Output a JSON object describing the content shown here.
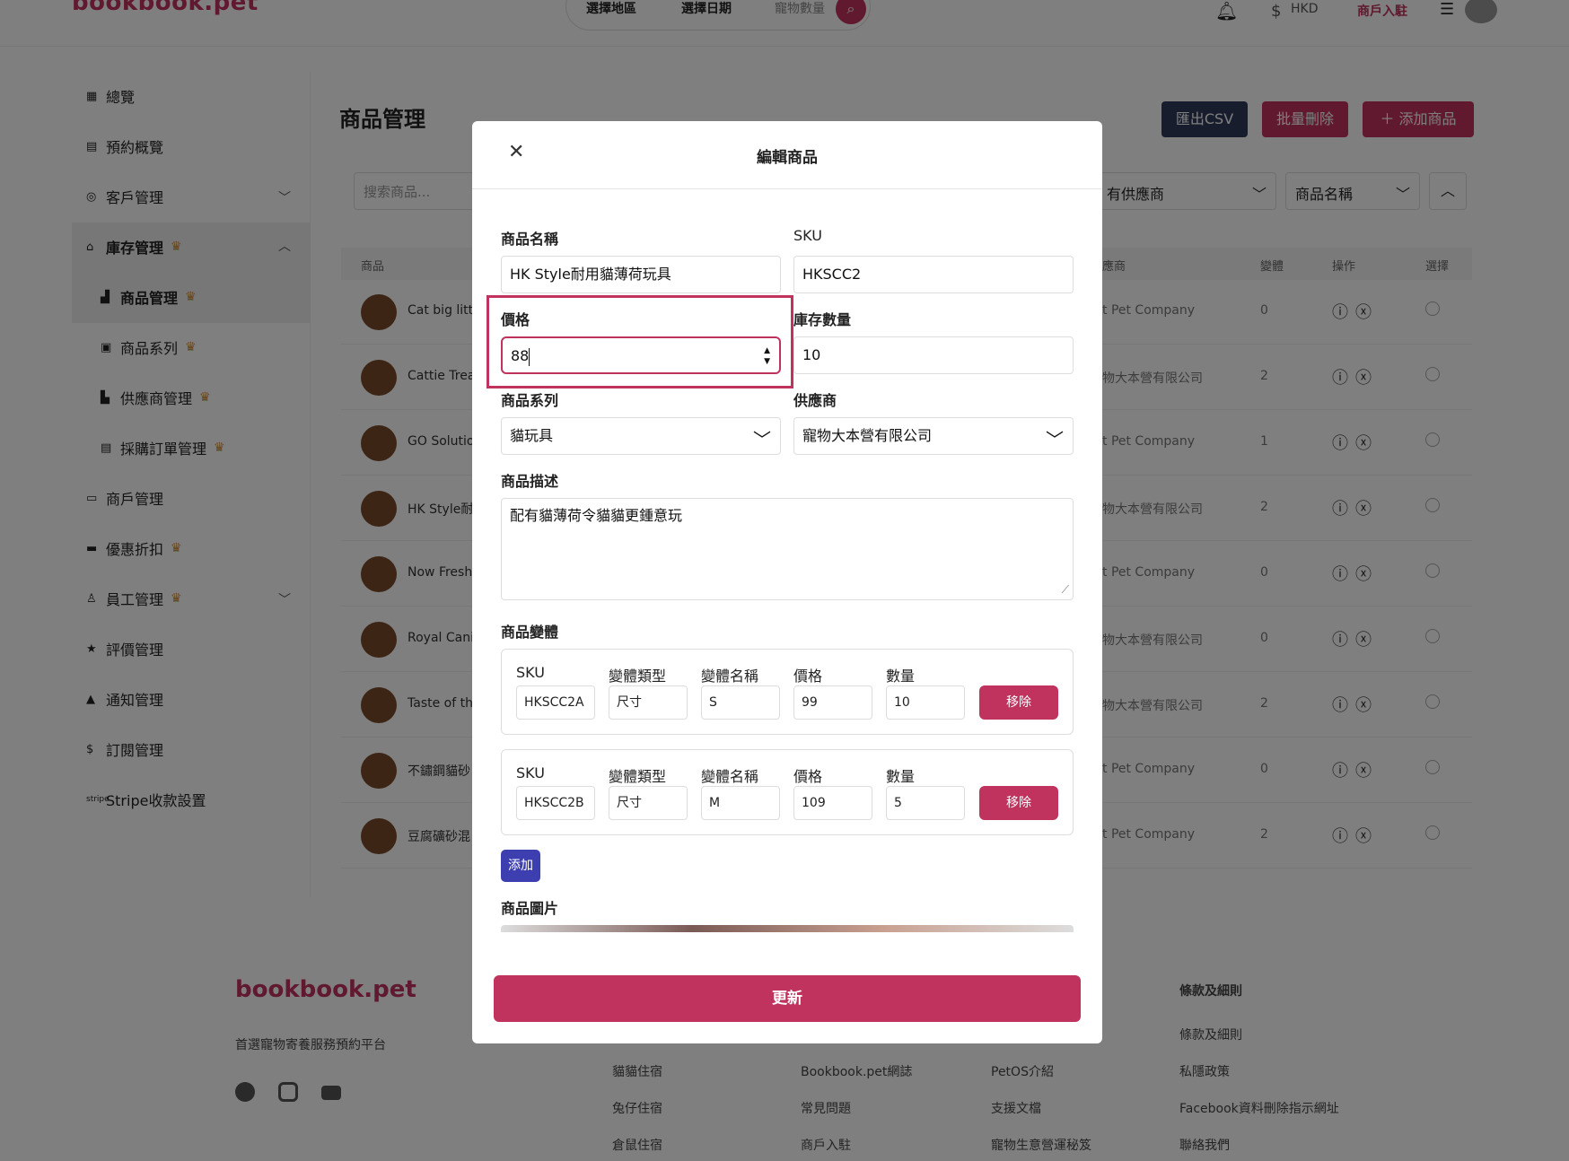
{
  "header": {
    "logo": "bookbook.pet",
    "search": {
      "region": "選擇地區",
      "date": "選擇日期",
      "pets": "寵物數量"
    },
    "currency": "HKD",
    "merchant": "商戶入駐"
  },
  "sidebar": {
    "items": [
      {
        "label": "總覽"
      },
      {
        "label": "預約概覽"
      },
      {
        "label": "客戶管理"
      },
      {
        "label": "庫存管理"
      },
      {
        "label": "商品管理"
      },
      {
        "label": "商品系列"
      },
      {
        "label": "供應商管理"
      },
      {
        "label": "採購訂單管理"
      },
      {
        "label": "商戶管理"
      },
      {
        "label": "優惠折扣"
      },
      {
        "label": "員工管理"
      },
      {
        "label": "評價管理"
      },
      {
        "label": "通知管理"
      },
      {
        "label": "訂閱管理"
      },
      {
        "label": "Stripe收款設置"
      }
    ]
  },
  "main": {
    "title": "商品管理",
    "buttons": {
      "export": "匯出CSV",
      "bulk_delete": "批量刪除",
      "add": "＋ 添加商品"
    },
    "search_placeholder": "搜索商品...",
    "filter_supplier": "有供應商",
    "sort_field": "商品名稱",
    "columns": {
      "product": "商品",
      "supplier": "應商",
      "variants": "變體",
      "actions": "操作",
      "select": "選擇"
    },
    "rows": [
      {
        "name": "Cat big litte",
        "supplier": "t Pet Company",
        "variants": "0"
      },
      {
        "name": "Cattie Treat",
        "supplier": "物大本營有限公司",
        "variants": "2"
      },
      {
        "name": "GO Solution",
        "supplier": "t Pet Company",
        "variants": "1"
      },
      {
        "name": "HK Style耐",
        "supplier": "物大本營有限公司",
        "variants": "2"
      },
      {
        "name": "Now Fresh",
        "supplier": "t Pet Company",
        "variants": "0"
      },
      {
        "name": "Royal Canin",
        "supplier": "物大本營有限公司",
        "variants": "0"
      },
      {
        "name": "Taste of the",
        "supplier": "物大本營有限公司",
        "variants": "2"
      },
      {
        "name": "不鏽鋼貓砂",
        "supplier": "t Pet Company",
        "variants": "0"
      },
      {
        "name": "豆腐礦砂混",
        "supplier": "t Pet Company",
        "variants": "2"
      }
    ]
  },
  "modal": {
    "title": "編輯商品",
    "name_label": "商品名稱",
    "name_value": "HK Style耐用貓薄荷玩具",
    "sku_label": "SKU",
    "sku_value": "HKSCC2",
    "price_label": "價格",
    "price_value": "88",
    "stock_label": "庫存數量",
    "stock_value": "10",
    "series_label": "商品系列",
    "series_value": "貓玩具",
    "supplier_label": "供應商",
    "supplier_value": "寵物大本營有限公司",
    "desc_label": "商品描述",
    "desc_value": "配有貓薄荷令貓貓更鍾意玩",
    "variants_label": "商品變體",
    "variant_headers": {
      "sku": "SKU",
      "type": "變體類型",
      "name": "變體名稱",
      "price": "價格",
      "qty": "數量"
    },
    "variants": [
      {
        "sku": "HKSCC2A",
        "type": "尺寸",
        "name": "S",
        "price": "99",
        "qty": "10",
        "remove": "移除"
      },
      {
        "sku": "HKSCC2B",
        "type": "尺寸",
        "name": "M",
        "price": "109",
        "qty": "5",
        "remove": "移除"
      }
    ],
    "add_label": "添加",
    "images_label": "商品圖片",
    "update_label": "更新"
  },
  "footer": {
    "logo": "bookbook.pet",
    "tagline": "首選寵物寄養服務預約平台",
    "col1": [
      "貓貓住宿",
      "兔仔住宿",
      "倉鼠住宿"
    ],
    "col2": [
      "Bookbook.pet網誌",
      "常見問題",
      "商戶入駐"
    ],
    "col3": [
      "PetOS介紹",
      "支援文檔",
      "寵物生意營運秘笈"
    ],
    "col4_title": "條款及細則",
    "col4": [
      "條款及細則",
      "私隱政策",
      "Facebook資料刪除指示網址",
      "聯絡我們"
    ]
  },
  "colors": {
    "brand": "#c0335e",
    "add_button": "#3d3fb0",
    "export_button": "#2f3a5a"
  }
}
